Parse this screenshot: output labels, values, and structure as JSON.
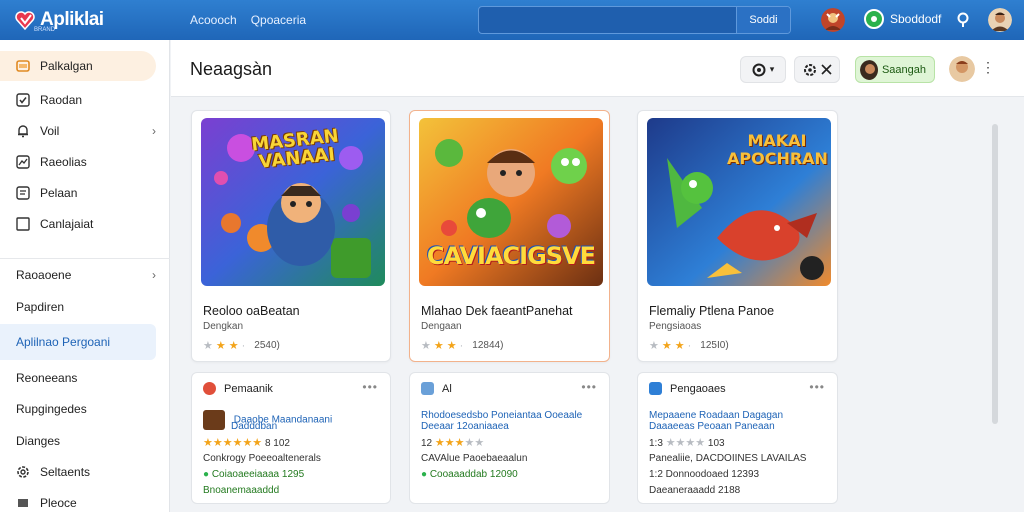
{
  "app": {
    "name": "Apliklai",
    "tagline": "BRAND"
  },
  "topbar": {
    "links": [
      "Acoooch",
      "Qpoaceria"
    ],
    "search": {
      "value": "",
      "placeholder": "",
      "button_label": "Soddi"
    },
    "status_label": "Sboddodf"
  },
  "sidebar": {
    "primary": [
      {
        "label": "Palkalgan",
        "icon": "paint-icon",
        "active": true
      },
      {
        "label": "Raodan",
        "icon": "check-icon"
      },
      {
        "label": "Voil",
        "icon": "bell-icon",
        "chevron": true
      },
      {
        "label": "Raeolias",
        "icon": "image-icon"
      },
      {
        "label": "Pelaan",
        "icon": "list-icon"
      },
      {
        "label": "Canlajaiat",
        "icon": "square-icon"
      }
    ],
    "secondary": [
      {
        "label": "Raoaoene",
        "chevron": true
      },
      {
        "label": "Papdiren"
      },
      {
        "label": "Aplilnao Pergoani",
        "selected": true
      },
      {
        "label": "Reoneeans"
      },
      {
        "label": "Rupgingedes"
      },
      {
        "label": "Dianges"
      },
      {
        "label": "Seltaents",
        "icon": "gear-icon"
      },
      {
        "label": "Pleoce",
        "icon": "flag-icon"
      }
    ]
  },
  "header": {
    "title": "Neaagsàn",
    "user_button_label": "Saangah",
    "more_label": "⋮"
  },
  "cards": [
    {
      "art_title": "MASRAN VANAAI",
      "title": "Reoloo oaBeatan",
      "subtitle": "Dengkan",
      "stars": 3,
      "rating_text": "2540)"
    },
    {
      "art_title": "CAVIACIGSVE",
      "title": "Mlahao Dek faeantPanehat",
      "subtitle": "Dengaan",
      "stars": 3,
      "rating_text": "12844)"
    },
    {
      "art_title": "MAKAI APOCHRAN",
      "title": "Flemaliy Ptlena Panoe",
      "subtitle": "Pengsiaoas",
      "stars": 3,
      "rating_text": "125I0)"
    }
  ],
  "mini_cards": [
    {
      "header": "Pemaanik",
      "rows": [
        {
          "text": "Daaobe Maandanaani",
          "kind": "link"
        },
        {
          "text": "Dadddban",
          "kind": "link"
        },
        {
          "text": "8 102",
          "stars": 5,
          "kind": "rating"
        },
        {
          "text": "Conkrogy Poeeoaltenerals",
          "kind": "plain"
        },
        {
          "text": "Coiaoaeeiaaaa 1295",
          "kind": "green"
        },
        {
          "text": "Bnoanemaaaddd",
          "kind": "green"
        }
      ]
    },
    {
      "header": "Al",
      "rows": [
        {
          "text": "Rhodoesedsbo Poneiantaa Ooeaale",
          "kind": "link"
        },
        {
          "text": "Deeaar 12oaniaaea",
          "kind": "link"
        },
        {
          "text": "12",
          "stars": 3,
          "kind": "rating"
        },
        {
          "text": "CAVAlue Paoebaeaalun",
          "kind": "plain"
        },
        {
          "text": "Cooaaaddab 12090",
          "kind": "green"
        }
      ]
    },
    {
      "header": "Pengaoaes",
      "rows": [
        {
          "text": "Mepaaene Roadaan Dagagan",
          "kind": "link"
        },
        {
          "text": "Daaaeeas Peoaan Paneaan",
          "kind": "link"
        },
        {
          "text": "1:3",
          "stars": 3,
          "kind": "rating",
          "extra": "103"
        },
        {
          "text": "Panealiie, DACDOIINES LAVAILAS",
          "kind": "plain"
        },
        {
          "text": "1:2 Donnoodoaed 12393",
          "kind": "plain"
        },
        {
          "text": "Daeaneraaadd 2188",
          "kind": "plain"
        }
      ]
    }
  ],
  "colors": {
    "topbar": "#2375c4",
    "accent": "#1e63b6",
    "star": "#f3a41a",
    "green": "#2bb24c"
  }
}
